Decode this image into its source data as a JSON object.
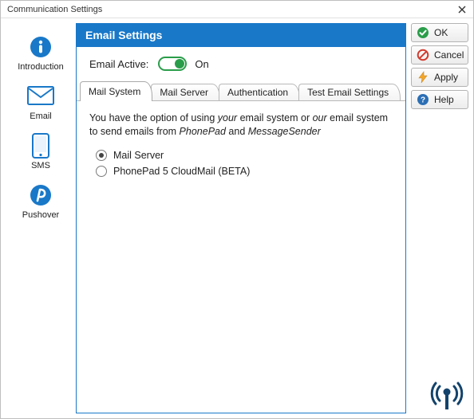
{
  "window": {
    "title": "Communication Settings"
  },
  "sidebar": {
    "items": [
      {
        "id": "introduction",
        "label": "Introduction"
      },
      {
        "id": "email",
        "label": "Email"
      },
      {
        "id": "sms",
        "label": "SMS"
      },
      {
        "id": "pushover",
        "label": "Pushover"
      }
    ],
    "selected_index": 1
  },
  "header": {
    "title": "Email Settings"
  },
  "toggle": {
    "label": "Email Active:",
    "state_label": "On",
    "on": true
  },
  "tabs": {
    "items": [
      {
        "id": "mail-system",
        "label": "Mail System"
      },
      {
        "id": "mail-server",
        "label": "Mail Server"
      },
      {
        "id": "authentication",
        "label": "Authentication"
      },
      {
        "id": "test-email-settings",
        "label": "Test Email Settings"
      }
    ],
    "active_index": 0
  },
  "mail_system": {
    "desc_pre": "You have the option of using ",
    "desc_your": "your",
    "desc_mid": " email system or ",
    "desc_our": "our",
    "desc_post1": " email system to send emails from ",
    "desc_app1": "PhonePad",
    "desc_and": " and ",
    "desc_app2": "MessageSender",
    "options": [
      {
        "id": "mail-server",
        "label": "Mail Server",
        "checked": true
      },
      {
        "id": "cloudmail",
        "label": "PhonePad 5 CloudMail (BETA)",
        "checked": false
      }
    ]
  },
  "buttons": {
    "ok": "OK",
    "cancel": "Cancel",
    "apply": "Apply",
    "help": "Help"
  },
  "colors": {
    "accent": "#1978c8",
    "ok": "#2a9d4a",
    "cancel": "#d23a2e",
    "apply": "#f3a62a",
    "help": "#2b6fb5"
  }
}
